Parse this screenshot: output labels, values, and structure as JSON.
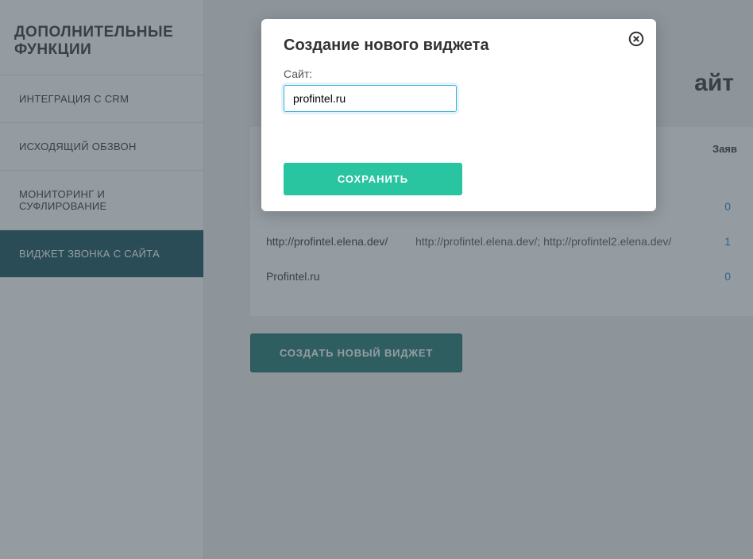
{
  "sidebar": {
    "title": "ДОПОЛНИТЕЛЬНЫЕ ФУНКЦИИ",
    "items": [
      {
        "label": "ИНТЕГРАЦИЯ С CRM",
        "active": false
      },
      {
        "label": "ИСХОДЯЩИЙ ОБЗВОН",
        "active": false
      },
      {
        "label": "МОНИТОРИНГ И СУФЛИРОВАНИЕ",
        "active": false
      },
      {
        "label": "ВИДЖЕТ ЗВОНКА С САЙТА",
        "active": true
      }
    ]
  },
  "main": {
    "page_title_suffix": "айт",
    "widgets_header_count": "Заяв",
    "widgets": [
      {
        "name": "http://profintel.elena.dev/",
        "sites": "http://profintel.elena.dev/; http://profintel2.elena.dev/",
        "count": "1"
      },
      {
        "name": "Profintel.ru",
        "sites": "",
        "count": "0"
      }
    ],
    "hidden_count": "0",
    "create_button": "СОЗДАТЬ НОВЫЙ ВИДЖЕТ"
  },
  "modal": {
    "title": "Создание нового виджета",
    "field_label": "Сайт:",
    "input_value": "profintel.ru",
    "save_button": "СОХРАНИТЬ"
  }
}
